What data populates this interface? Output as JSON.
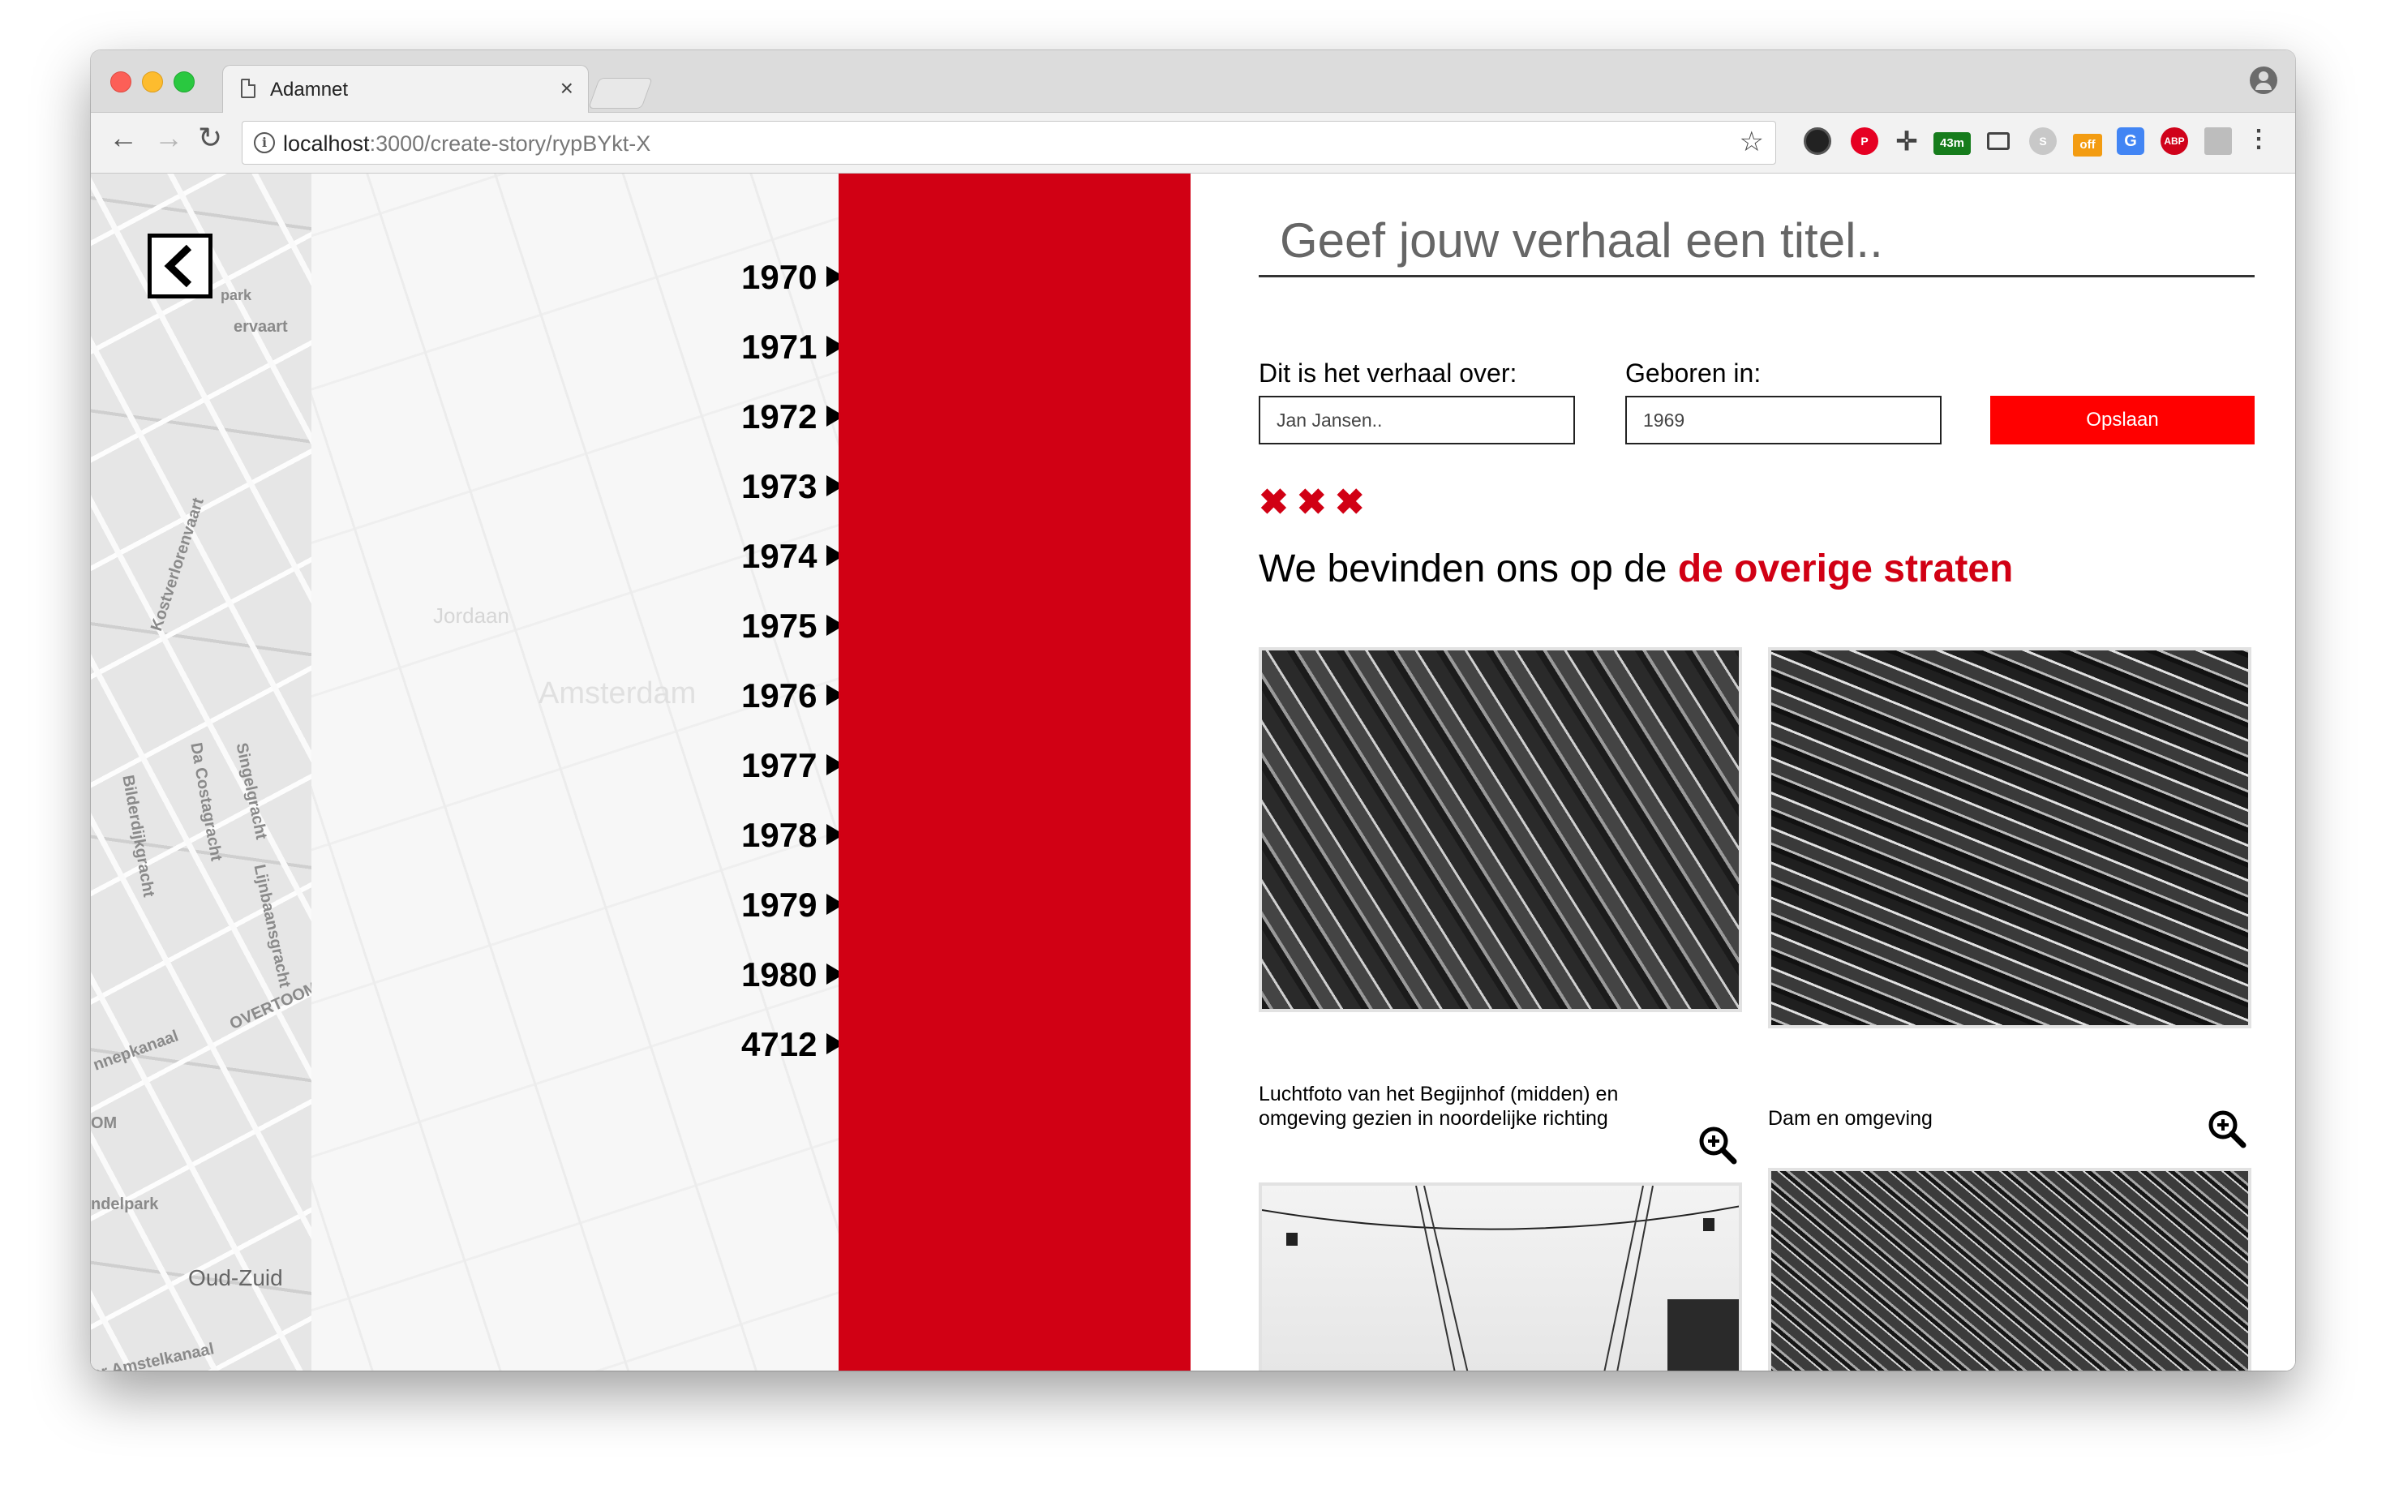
{
  "browser": {
    "tab_title": "Adamnet",
    "tab_close": "×",
    "url_host": "localhost",
    "url_rest": ":3000/create-story/rypBYkt-X",
    "extensions": [
      "record-icon",
      "pinterest-icon",
      "move-icon",
      "timer-badge-icon",
      "screenshot-icon",
      "skype-icon",
      "offer-icon",
      "translate-icon",
      "adblock-icon",
      "qr-icon"
    ],
    "timer_badge": "43m",
    "offer_badge": "off",
    "adblock_badge": "ABP"
  },
  "map": {
    "labels": [
      "Jordaan",
      "Amsterdam",
      "Oud-Zuid",
      "Kostverlorenvaart",
      "Da Costagracht",
      "Bilderdijkgracht",
      "Singelgracht",
      "Lijnbaansgracht",
      "OVERTOOM",
      "nnepkanaal",
      "ndelpark",
      "er Amstelkanaal",
      "ervaart",
      "park",
      "OM"
    ]
  },
  "timeline": {
    "years": [
      "1970",
      "1971",
      "1972",
      "1973",
      "1974",
      "1975",
      "1976",
      "1977",
      "1978",
      "1979",
      "1980",
      "4712"
    ]
  },
  "form": {
    "title_placeholder": "Geef jouw verhaal een titel..",
    "about_label": "Dit is het verhaal over:",
    "about_placeholder": "Jan Jansen..",
    "born_label": "Geboren in:",
    "born_placeholder": "1969",
    "save_label": "Opslaan"
  },
  "location": {
    "marks": "✖✖✖",
    "prefix": "We bevinden ons op de ",
    "highlight": "de overige straten"
  },
  "photos": [
    {
      "caption": "Luchtfoto van het Begijnhof (midden) en omgeving gezien in noordelijke richting"
    },
    {
      "caption": "Dam en omgeving"
    }
  ],
  "colors": {
    "accent_red": "#d10014",
    "button_red": "#ff0000"
  }
}
